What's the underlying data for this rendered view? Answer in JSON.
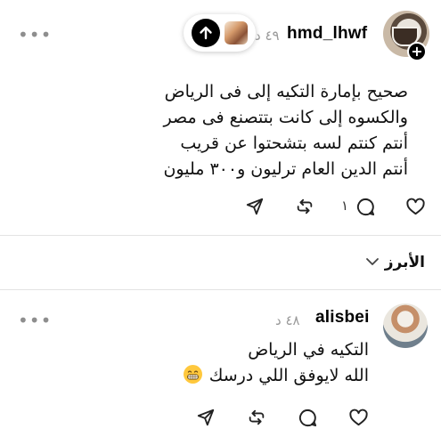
{
  "post1": {
    "username": "hmd_lhwf",
    "time": "٤٩ د",
    "lines": [
      "صحيح بإمارة التكيه إلى فى الرياض",
      "والكسوه إلى كانت بتتصنع فى مصر",
      "أنتم كنتم لسه بتشحتوا عن قريب",
      "أنتم الدين العام ترليون و٣٠٠ مليون"
    ],
    "reply_count": "١",
    "more_label": "•••"
  },
  "sort": {
    "label": "الأبرز"
  },
  "post2": {
    "username": "alisbei",
    "time": "٤٨ د",
    "lines": [
      "التكيه في الرياض",
      "الله لايوفق اللي درسك"
    ],
    "more_label": "•••"
  },
  "colors": {
    "background": "#ffffff",
    "text": "#000000",
    "muted": "#9a9a9a",
    "divider": "#e3e3e3"
  }
}
